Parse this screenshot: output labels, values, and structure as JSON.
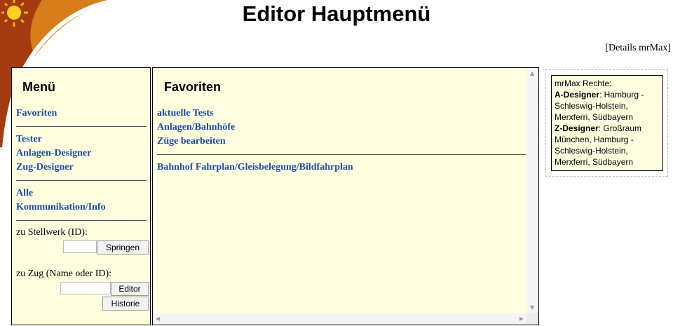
{
  "page": {
    "title": "Editor Hauptmenü",
    "details_link": "[Details mrMax]"
  },
  "menu": {
    "heading": "Menü",
    "group1": [
      {
        "label": "Favoriten"
      }
    ],
    "group2": [
      {
        "label": "Tester"
      },
      {
        "label": "Anlagen-Designer"
      },
      {
        "label": "Zug-Designer"
      }
    ],
    "group3": [
      {
        "label": "Alle"
      },
      {
        "label": "Kommunikation/Info"
      }
    ],
    "stellwerk": {
      "label": "zu Stellwerk (ID):",
      "input_value": "",
      "button_label": "Springen"
    },
    "zug": {
      "label": "zu Zug (Name oder ID):",
      "input_value": "",
      "editor_button_label": "Editor",
      "historie_button_label": "Historie"
    }
  },
  "favorites": {
    "heading": "Favoriten",
    "links": [
      {
        "label": "aktuelle Tests"
      },
      {
        "label": "Anlagen/Bahnhöfe"
      },
      {
        "label": "Züge bearbeiten"
      }
    ],
    "links2": [
      {
        "label": "Bahnhof Fahrplan/Gleisbelegung/Bildfahrplan"
      }
    ]
  },
  "rights": {
    "title": "mrMax Rechte:",
    "a_designer_label": "A-Designer",
    "a_designer_value": ": Hamburg - Schleswig-Holstein, Merxferri, Südbayern",
    "z_designer_label": "Z-Designer",
    "z_designer_value": ": Großraum München, Hamburg - Schleswig-Holstein, Merxferri, Südbayern"
  },
  "colors": {
    "panel_bg": "#ffffe0",
    "link": "#1a4aa8",
    "arc_dark": "#a33a10",
    "arc_orange": "#e08a1c",
    "sun": "#ffcc00"
  }
}
